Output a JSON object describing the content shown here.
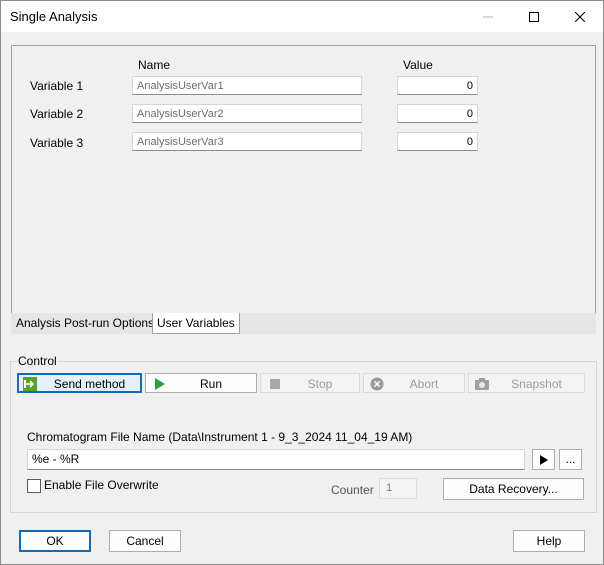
{
  "window": {
    "title": "Single Analysis",
    "controls": {
      "minimize": "—",
      "maximize": "☐",
      "close": "✕"
    }
  },
  "variables": {
    "name_header": "Name",
    "value_header": "Value",
    "rows": [
      {
        "label": "Variable 1",
        "name": "AnalysisUserVar1",
        "value": "0"
      },
      {
        "label": "Variable 2",
        "name": "AnalysisUserVar2",
        "value": "0"
      },
      {
        "label": "Variable 3",
        "name": "AnalysisUserVar3",
        "value": "0"
      }
    ]
  },
  "tabs": [
    {
      "label": "Analysis",
      "active": false
    },
    {
      "label": "Post-run Options",
      "active": false
    },
    {
      "label": "User Variables",
      "active": true
    }
  ],
  "control": {
    "group_label": "Control",
    "buttons": [
      {
        "label": "Send method",
        "icon": "send-icon",
        "enabled": true,
        "accent": "#5aa02c"
      },
      {
        "label": "Run",
        "icon": "play-icon",
        "enabled": true,
        "accent": "#2e9e3e"
      },
      {
        "label": "Stop",
        "icon": "stop-icon",
        "enabled": false
      },
      {
        "label": "Abort",
        "icon": "abort-icon",
        "enabled": false
      },
      {
        "label": "Snapshot",
        "icon": "camera-icon",
        "enabled": false
      }
    ],
    "file_label": "Chromatogram File Name (Data\\Instrument 1 - 9_3_2024 11_04_19 AM)",
    "file_value": "%e - %R",
    "arrow_button": "▶",
    "browse_button": "...",
    "overwrite_label": "Enable File Overwrite",
    "overwrite_checked": false,
    "counter_label": "Counter",
    "counter_value": "1",
    "data_recovery": "Data Recovery..."
  },
  "footer": {
    "ok": "OK",
    "cancel": "Cancel",
    "help": "Help"
  },
  "colors": {
    "accent_blue": "#0f6cbd",
    "run_green": "#2e9e3e"
  }
}
